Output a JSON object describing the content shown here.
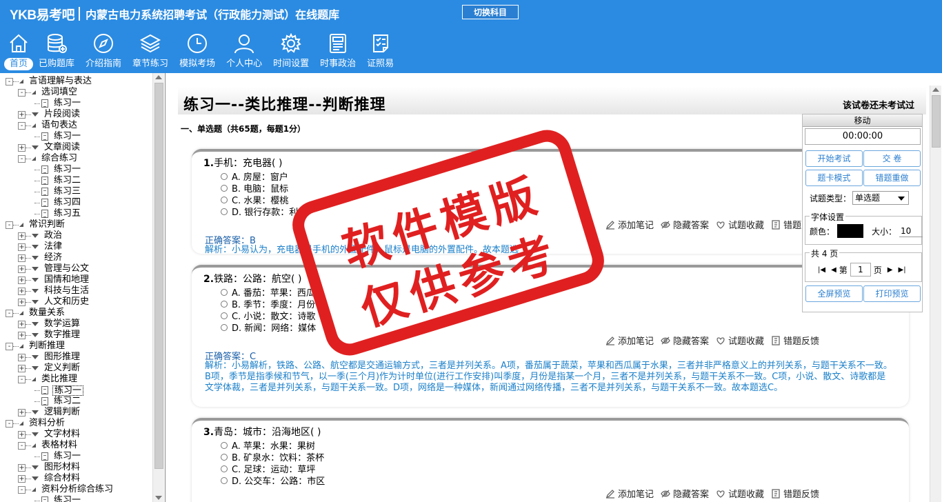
{
  "header": {
    "logo": "YKB易考吧",
    "title": "内蒙古电力系统招聘考试（行政能力测试）在线题库",
    "switch_label": "切换科目"
  },
  "nav": [
    {
      "label": "首页",
      "icon": "home-icon"
    },
    {
      "label": "已购题库",
      "icon": "database-icon"
    },
    {
      "label": "介绍指南",
      "icon": "compass-icon"
    },
    {
      "label": "章节练习",
      "icon": "layers-icon"
    },
    {
      "label": "模拟考场",
      "icon": "clock-icon"
    },
    {
      "label": "个人中心",
      "icon": "user-icon"
    },
    {
      "label": "时间设置",
      "icon": "gear-icon"
    },
    {
      "label": "时事政治",
      "icon": "newspaper-icon"
    },
    {
      "label": "证照易",
      "icon": "checklist-icon"
    }
  ],
  "tree": [
    {
      "label": "言语理解与表达",
      "depth": 0,
      "toggle": "-",
      "kind": "folder-open"
    },
    {
      "label": "选词填空",
      "depth": 1,
      "toggle": "-",
      "kind": "folder-open"
    },
    {
      "label": "练习一",
      "depth": 2,
      "kind": "doc"
    },
    {
      "label": "片段阅读",
      "depth": 1,
      "toggle": "+",
      "kind": "folder"
    },
    {
      "label": "语句表达",
      "depth": 1,
      "toggle": "-",
      "kind": "folder-open"
    },
    {
      "label": "练习一",
      "depth": 2,
      "kind": "doc"
    },
    {
      "label": "文章阅读",
      "depth": 1,
      "toggle": "+",
      "kind": "folder"
    },
    {
      "label": "综合练习",
      "depth": 1,
      "toggle": "-",
      "kind": "folder-open"
    },
    {
      "label": "练习一",
      "depth": 2,
      "kind": "doc"
    },
    {
      "label": "练习二",
      "depth": 2,
      "kind": "doc"
    },
    {
      "label": "练习三",
      "depth": 2,
      "kind": "doc"
    },
    {
      "label": "练习四",
      "depth": 2,
      "kind": "doc"
    },
    {
      "label": "练习五",
      "depth": 2,
      "kind": "doc"
    },
    {
      "label": "常识判断",
      "depth": 0,
      "toggle": "-",
      "kind": "folder-open"
    },
    {
      "label": "政治",
      "depth": 1,
      "toggle": "+",
      "kind": "folder"
    },
    {
      "label": "法律",
      "depth": 1,
      "toggle": "+",
      "kind": "folder"
    },
    {
      "label": "经济",
      "depth": 1,
      "toggle": "+",
      "kind": "folder"
    },
    {
      "label": "管理与公文",
      "depth": 1,
      "toggle": "+",
      "kind": "folder"
    },
    {
      "label": "国情和地理",
      "depth": 1,
      "toggle": "+",
      "kind": "folder"
    },
    {
      "label": "科技与生活",
      "depth": 1,
      "toggle": "+",
      "kind": "folder"
    },
    {
      "label": "人文和历史",
      "depth": 1,
      "toggle": "+",
      "kind": "folder"
    },
    {
      "label": "数量关系",
      "depth": 0,
      "toggle": "-",
      "kind": "folder-open"
    },
    {
      "label": "数学运算",
      "depth": 1,
      "toggle": "+",
      "kind": "folder"
    },
    {
      "label": "数字推理",
      "depth": 1,
      "toggle": "+",
      "kind": "folder"
    },
    {
      "label": "判断推理",
      "depth": 0,
      "toggle": "-",
      "kind": "folder-open"
    },
    {
      "label": "图形推理",
      "depth": 1,
      "toggle": "+",
      "kind": "folder"
    },
    {
      "label": "定义判断",
      "depth": 1,
      "toggle": "+",
      "kind": "folder"
    },
    {
      "label": "类比推理",
      "depth": 1,
      "toggle": "-",
      "kind": "folder-open"
    },
    {
      "label": "练习一",
      "depth": 2,
      "kind": "doc",
      "selected": true
    },
    {
      "label": "练习二",
      "depth": 2,
      "kind": "doc"
    },
    {
      "label": "逻辑判断",
      "depth": 1,
      "toggle": "+",
      "kind": "folder"
    },
    {
      "label": "资料分析",
      "depth": 0,
      "toggle": "-",
      "kind": "folder-open"
    },
    {
      "label": "文字材料",
      "depth": 1,
      "toggle": "+",
      "kind": "folder"
    },
    {
      "label": "表格材料",
      "depth": 1,
      "toggle": "-",
      "kind": "folder-open"
    },
    {
      "label": "练习一",
      "depth": 2,
      "kind": "doc"
    },
    {
      "label": "图形材料",
      "depth": 1,
      "toggle": "+",
      "kind": "folder"
    },
    {
      "label": "综合材料",
      "depth": 1,
      "toggle": "+",
      "kind": "folder"
    },
    {
      "label": "资料分析综合练习",
      "depth": 1,
      "toggle": "-",
      "kind": "folder-open"
    },
    {
      "label": "练习一",
      "depth": 2,
      "kind": "doc"
    }
  ],
  "main": {
    "title": "练习一--类比推理--判断推理",
    "status": "该试卷还未考试过",
    "section": "一、单选题（共65题，每题1分）",
    "actions": {
      "note": "添加笔记",
      "hide": "隐藏答案",
      "fav": "试题收藏",
      "report": "错题反馈"
    },
    "answer_prefix": "正确答案：",
    "questions": [
      {
        "num": "1.",
        "stem": "手机：充电器( )",
        "options": [
          "A. 房屋：窗户",
          "B. 电脑：鼠标",
          "C. 水果：樱桃",
          "D. 银行存款：利息"
        ],
        "answer": "B",
        "analysis": "解析：小易认为，充电器是手机的外置配件，鼠标是电脑的外置配件。故本题选"
      },
      {
        "num": "2.",
        "stem": "铁路：公路：航空( )",
        "options": [
          "A. 番茄：苹果：西瓜",
          "B. 季节：季度：月份",
          "C. 小说：散文：诗歌",
          "D. 新闻：网络：媒体"
        ],
        "answer": "C",
        "analysis": "解析：小易解析，铁路、公路、航空都是交通运输方式，三者是并列关系。A项，番茄属于蔬菜，苹果和西瓜属于水果，三者并非严格意义上的并列关系，与题干关系不一致。B项，季节是指季候和节气，以一季(三个月)作为计时单位(进行工作安排)叫季度，月份是指某一个月，三者不是并列关系，与题干关系不一致。C项，小说、散文、诗歌都是文学体裁，三者是并列关系，与题干关系一致。D项，网络是一种媒体，新闻通过网络传播，三者不是并列关系，与题干关系不一致。故本题选C。"
      },
      {
        "num": "3.",
        "stem": "青岛：城市：沿海地区( )",
        "options": [
          "A. 苹果：水果：果树",
          "B. 矿泉水：饮料：茶杯",
          "C. 足球：运动：草坪",
          "D. 公交车：公路：市区"
        ],
        "answer": "",
        "analysis": ""
      }
    ]
  },
  "panel": {
    "move_label": "移动",
    "timer": "00:00:00",
    "start_label": "开始考试",
    "submit_label": "交  卷",
    "card_mode_label": "题卡模式",
    "redo_label": "错题重做",
    "type_label": "试题类型：",
    "type_value": "单选题",
    "font_legend": "字体设置",
    "color_label": "颜色：",
    "size_label": "大小：",
    "size_value": "10",
    "page_legend": "共 4 页",
    "page_prefix": "第",
    "page_value": "1",
    "page_suffix": "页",
    "fullscreen_label": "全屏预览",
    "print_label": "打印预览",
    "font_color": "#000000"
  },
  "watermark": {
    "line1": "软件模版",
    "line2": "仅供参考",
    "color": "#e02020"
  }
}
